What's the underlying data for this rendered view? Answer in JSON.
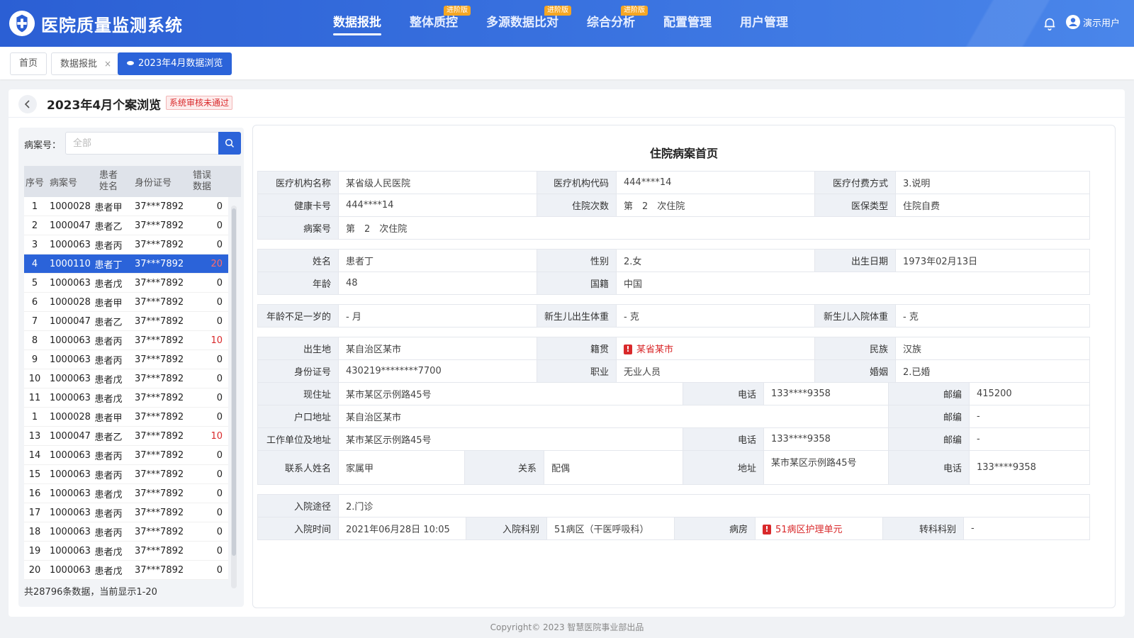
{
  "header": {
    "app_title": "医院质量监测系统",
    "nav": [
      {
        "label": "数据报批",
        "badge": ""
      },
      {
        "label": "整体质控",
        "badge": "进阶版"
      },
      {
        "label": "多源数据比对",
        "badge": "进阶版"
      },
      {
        "label": "综合分析",
        "badge": "进阶版"
      },
      {
        "label": "配置管理",
        "badge": ""
      },
      {
        "label": "用户管理",
        "badge": ""
      }
    ],
    "user_name": "演示用户"
  },
  "tabs": [
    {
      "label": "首页"
    },
    {
      "label": "数据报批",
      "close": "×"
    },
    {
      "label": "2023年4月数据浏览"
    }
  ],
  "page": {
    "title": "2023年4月个案浏览",
    "status": "系统审核未通过"
  },
  "search": {
    "label": "病案号：",
    "placeholder": "全部"
  },
  "list": {
    "headers": {
      "no": "序号",
      "case": "病案号",
      "name": "患者姓名",
      "id": "身份证号",
      "err": "错误数据"
    },
    "rows": [
      {
        "no": "1",
        "case": "1000028",
        "name": "患者甲",
        "id": "37***7892",
        "err": "0"
      },
      {
        "no": "2",
        "case": "1000047",
        "name": "患者乙",
        "id": "37***7892",
        "err": "0"
      },
      {
        "no": "3",
        "case": "1000063",
        "name": "患者丙",
        "id": "37***7892",
        "err": "0"
      },
      {
        "no": "4",
        "case": "1000110",
        "name": "患者丁",
        "id": "37***7892",
        "err": "20"
      },
      {
        "no": "5",
        "case": "1000063",
        "name": "患者戊",
        "id": "37***7892",
        "err": "0"
      },
      {
        "no": "6",
        "case": "1000028",
        "name": "患者甲",
        "id": "37***7892",
        "err": "0"
      },
      {
        "no": "7",
        "case": "1000047",
        "name": "患者乙",
        "id": "37***7892",
        "err": "0"
      },
      {
        "no": "8",
        "case": "1000063",
        "name": "患者丙",
        "id": "37***7892",
        "err": "10"
      },
      {
        "no": "9",
        "case": "1000063",
        "name": "患者丙",
        "id": "37***7892",
        "err": "0"
      },
      {
        "no": "10",
        "case": "1000063",
        "name": "患者戊",
        "id": "37***7892",
        "err": "0"
      },
      {
        "no": "11",
        "case": "1000063",
        "name": "患者戊",
        "id": "37***7892",
        "err": "0"
      },
      {
        "no": "1",
        "case": "1000028",
        "name": "患者甲",
        "id": "37***7892",
        "err": "0"
      },
      {
        "no": "13",
        "case": "1000047",
        "name": "患者乙",
        "id": "37***7892",
        "err": "10"
      },
      {
        "no": "14",
        "case": "1000063",
        "name": "患者丙",
        "id": "37***7892",
        "err": "0"
      },
      {
        "no": "15",
        "case": "1000063",
        "name": "患者丙",
        "id": "37***7892",
        "err": "0"
      },
      {
        "no": "16",
        "case": "1000063",
        "name": "患者戊",
        "id": "37***7892",
        "err": "0"
      },
      {
        "no": "17",
        "case": "1000063",
        "name": "患者丙",
        "id": "37***7892",
        "err": "0"
      },
      {
        "no": "18",
        "case": "1000063",
        "name": "患者丙",
        "id": "37***7892",
        "err": "0"
      },
      {
        "no": "19",
        "case": "1000063",
        "name": "患者戊",
        "id": "37***7892",
        "err": "0"
      },
      {
        "no": "20",
        "case": "1000063",
        "name": "患者戊",
        "id": "37***7892",
        "err": "0"
      }
    ],
    "selected_index": 3,
    "footer": "共28796条数据，当前显示1-20"
  },
  "form": {
    "title": "住院病案首页",
    "org_name_label": "医疗机构名称",
    "org_name": "某省级人民医院",
    "org_code_label": "医疗机构代码",
    "org_code": "444****14",
    "pay_label": "医疗付费方式",
    "pay": "3.说明",
    "health_card_label": "健康卡号",
    "health_card": "444****14",
    "times_label": "住院次数",
    "times": "第　2　次住院",
    "insurance_label": "医保类型",
    "insurance": "住院自费",
    "case_no_label": "病案号",
    "case_no": "第　2　次住院",
    "name_label": "姓名",
    "name": "患者丁",
    "gender_label": "性别",
    "gender": "2.女",
    "birth_label": "出生日期",
    "birth": "1973年02月13日",
    "age_label": "年龄",
    "age": "48",
    "nation_label": "国籍",
    "nation": "中国",
    "infant_age_label": "年龄不足一岁的",
    "infant_age": "- 月",
    "newborn_weight_label": "新生儿出生体重",
    "newborn_weight": "- 克",
    "newborn_admit_label": "新生儿入院体重",
    "newborn_admit": "- 克",
    "birthplace_label": "出生地",
    "birthplace": "某自治区某市",
    "native_label": "籍贯",
    "native": "某省某市",
    "ethnic_label": "民族",
    "ethnic": "汉族",
    "idcard_label": "身份证号",
    "idcard": "430219********7700",
    "job_label": "职业",
    "job": "无业人员",
    "marriage_label": "婚姻",
    "marriage": "2.已婚",
    "address_label": "现住址",
    "address": "某市某区示例路45号",
    "phone_label": "电话",
    "phone": "133****9358",
    "zip_label": "邮编",
    "zip": "415200",
    "hukou_label": "户口地址",
    "hukou": "某自治区某市",
    "hukou_zip": "-",
    "work_label": "工作单位及地址",
    "work": "某市某区示例路45号",
    "work_phone": "133****9358",
    "work_zip": "-",
    "contact_label": "联系人姓名",
    "contact": "家属甲",
    "relation_label": "关系",
    "relation": "配偶",
    "contact_addr_label": "地址",
    "contact_addr": "某市某区示例路45号",
    "contact_phone": "133****9358",
    "admit_route_label": "入院途径",
    "admit_route": "2.门诊",
    "admit_time_label": "入院时间",
    "admit_time": "2021年06月28日 10:05",
    "admit_dept_label": "入院科别",
    "admit_dept": "51病区（干医呼吸科）",
    "ward_label": "病房",
    "ward": "51病区护理单元",
    "transfer_label": "转科科别",
    "transfer": "-"
  },
  "copyright": "Copyright© 2023 智慧医院事业部出品",
  "colors": {
    "primary": "#2b63d9",
    "warning": "#d9292b",
    "badge": "#f5a623"
  }
}
